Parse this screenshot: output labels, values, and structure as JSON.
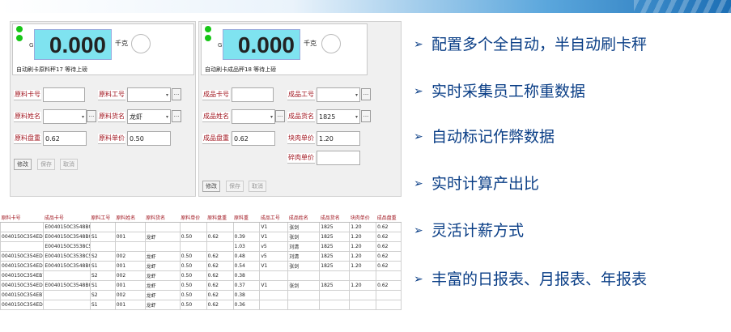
{
  "scales": [
    {
      "g_label": "G",
      "weight": "0.000",
      "unit": "千克",
      "status": "自动刷卡原料秤17 等待上磅",
      "fields": {
        "card_label": "原料卡号",
        "card_value": "",
        "worker_id_label": "原料工号",
        "worker_id_value": "",
        "name_label": "原料姓名",
        "name_value": "",
        "goods_label": "原料货名",
        "goods_value": "龙虾",
        "tray_label": "原料盘重",
        "tray_value": "0.62",
        "price_label": "原料单价",
        "price_value": "0.50"
      },
      "buttons": {
        "edit": "修改",
        "save": "保存",
        "cancel": "取消"
      }
    },
    {
      "g_label": "G",
      "weight": "0.000",
      "unit": "千克",
      "status": "自动刷卡成品秤18 等待上磅",
      "fields": {
        "card_label": "成品卡号",
        "card_value": "",
        "worker_id_label": "成品工号",
        "worker_id_value": "",
        "name_label": "成品姓名",
        "name_value": "",
        "goods_label": "成品货名",
        "goods_value": "1825",
        "tray_label": "成品盘重",
        "tray_value": "0.62",
        "block_price_label": "块肉单价",
        "block_price_value": "1.20",
        "crumb_price_label": "碎肉单价",
        "crumb_price_value": ""
      },
      "buttons": {
        "edit": "修改",
        "save": "保存",
        "cancel": "取消"
      }
    }
  ],
  "table": {
    "headers": [
      "原料卡号",
      "成品卡号",
      "原料工号",
      "原料姓名",
      "原料货名",
      "原料单价",
      "原料盘重",
      "原料重",
      "成品工号",
      "成品姓名",
      "成品货名",
      "块肉单价",
      "成品盘重"
    ],
    "rows": [
      [
        "",
        "E0040150C3548B00",
        "",
        "",
        "",
        "",
        "",
        "",
        "V1",
        "张剑",
        "1825",
        "1.20",
        "0.62"
      ],
      [
        "0040150C354EDEF",
        "E0040150C3548B00",
        "S1",
        "001",
        "龙虾",
        "0.50",
        "0.62",
        "0.39",
        "V1",
        "张剑",
        "1825",
        "1.20",
        "0.62"
      ],
      [
        "",
        "E0040150C3538C5",
        "",
        "",
        "",
        "",
        "",
        "1.03",
        "v5",
        "刘清",
        "1825",
        "1.20",
        "0.62"
      ],
      [
        "0040150C354EDEF",
        "E0040150C3538C5",
        "S2",
        "002",
        "龙虾",
        "0.50",
        "0.62",
        "0.48",
        "v5",
        "刘清",
        "1825",
        "1.20",
        "0.62"
      ],
      [
        "0040150C354EDEF",
        "E0040150C3548B00",
        "S1",
        "001",
        "龙虾",
        "0.50",
        "0.62",
        "0.54",
        "V1",
        "张剑",
        "1825",
        "1.20",
        "0.62"
      ],
      [
        "0040150C354EB7T",
        "",
        "S2",
        "002",
        "龙虾",
        "0.50",
        "0.62",
        "0.38",
        "",
        "",
        "",
        "",
        ""
      ],
      [
        "0040150C354EDEF",
        "E0040150C3548B00",
        "S1",
        "001",
        "龙虾",
        "0.50",
        "0.62",
        "0.37",
        "V1",
        "张剑",
        "1825",
        "1.20",
        "0.62"
      ],
      [
        "0040150C354EB7T",
        "",
        "S2",
        "002",
        "龙虾",
        "0.50",
        "0.62",
        "0.38",
        "",
        "",
        "",
        "",
        ""
      ],
      [
        "0040150C354EDEF",
        "",
        "S1",
        "001",
        "龙虾",
        "0.50",
        "0.62",
        "0.36",
        "",
        "",
        "",
        "",
        ""
      ]
    ]
  },
  "features": [
    "配置多个全自动，半自动刷卡秤",
    "实时采集员工称重数据",
    "自动标记作弊数据",
    "实时计算产出比",
    "灵活计薪方式",
    "丰富的日报表、月报表、年报表"
  ],
  "bullet_marker": "➢",
  "colors": {
    "label_red": "#a0141e",
    "weight_bg": "#7fe3f0",
    "status_green": "#17c617",
    "feature_blue": "#0a3e86"
  }
}
